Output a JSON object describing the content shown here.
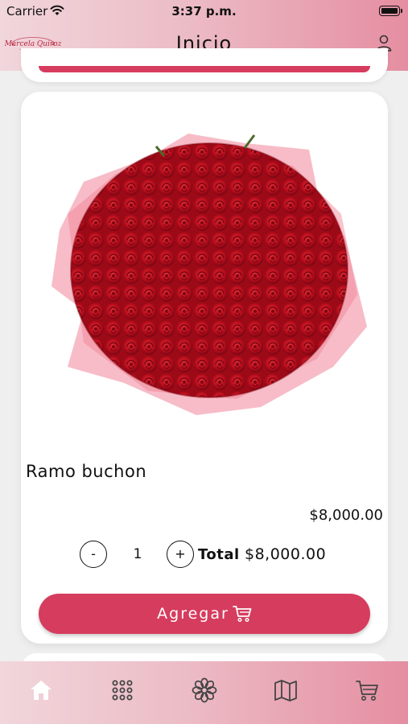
{
  "status_bar": {
    "carrier": "Carrier",
    "time": "3:37 p.m.",
    "icons": [
      "wifi-icon",
      "battery-icon"
    ]
  },
  "header": {
    "title": "Inicio",
    "logo_text": "Marcela Quiroz",
    "icons": [
      "logo",
      "profile-icon"
    ]
  },
  "product": {
    "name": "Ramo buchon",
    "price": "$8,000.00",
    "quantity": "1",
    "minus_label": "-",
    "plus_label": "+",
    "total_label": "Total",
    "total_amount": "$8,000.00",
    "add_label": "Agregar",
    "image": "red-roses-bouquet"
  },
  "tab_bar": {
    "items": [
      "home-icon",
      "grid-icon",
      "flower-icon",
      "map-icon",
      "cart-icon"
    ],
    "active": "home-icon"
  },
  "colors": {
    "accent": "#d63c5e",
    "bar_gradient_start": "#f1d6db",
    "bar_gradient_end": "#e58ea1",
    "active_tab": "#ffffff",
    "inactive_tab": "#444444"
  }
}
